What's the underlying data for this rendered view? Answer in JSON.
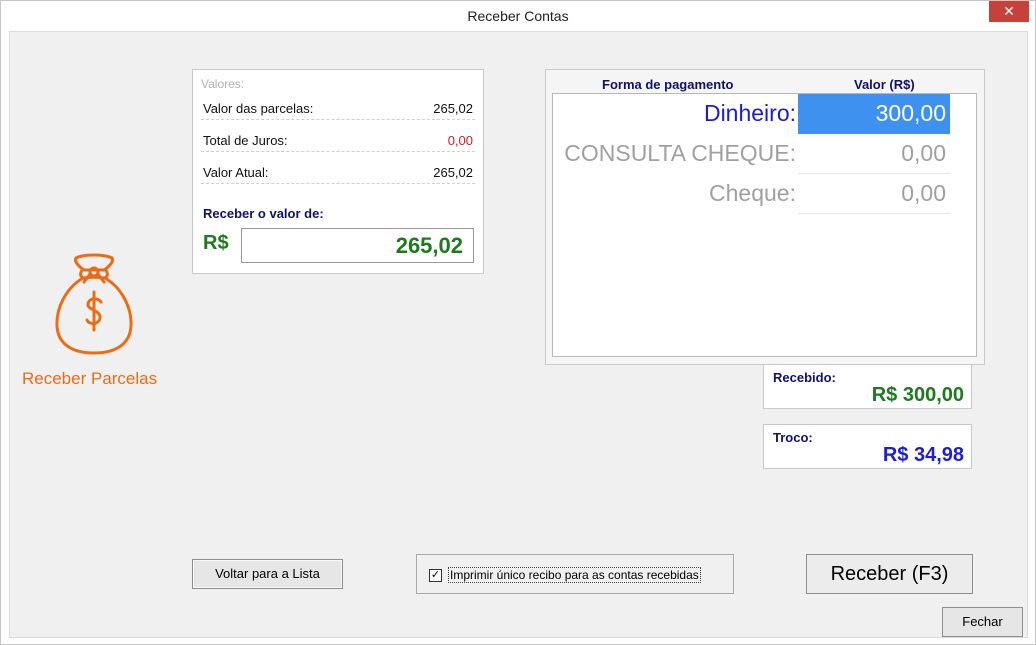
{
  "window": {
    "title": "Receber Contas",
    "close_glyph": "✕"
  },
  "logo": {
    "icon": "money-bag-icon",
    "label": "Receber Parcelas",
    "color": "#ec6c16"
  },
  "values": {
    "legend": "Valores:",
    "rows": [
      {
        "label": "Valor das parcelas:",
        "value": "265,02"
      },
      {
        "label": "Total de Juros:",
        "value": "0,00"
      },
      {
        "label": "Valor Atual:",
        "value": "265,02"
      }
    ],
    "receber_label": "Receber o valor de:",
    "currency": "R$",
    "receber_value": "265,02"
  },
  "payment": {
    "col_forma": "Forma de pagamento",
    "col_valor": "Valor (R$)",
    "methods": [
      {
        "label": "Dinheiro:",
        "value": "300,00",
        "selected": true
      },
      {
        "label": "CONSULTA CHEQUE:",
        "value": "0,00",
        "selected": false
      },
      {
        "label": "Cheque:",
        "value": "0,00",
        "selected": false
      }
    ]
  },
  "totals": {
    "recebido_label": "Recebido:",
    "recebido_value": "R$ 300,00",
    "troco_label": "Troco:",
    "troco_value": "R$ 34,98"
  },
  "actions": {
    "voltar": "Voltar para a Lista",
    "print_checked": true,
    "print_check_glyph": "✓",
    "print_label": "Imprimir único recibo para as contas recebidas",
    "receber": "Receber (F3)",
    "fechar": "Fechar"
  },
  "colors": {
    "accent_blue": "#3f91f0",
    "dark_navy": "#10106e",
    "money_green": "#1d7a1d",
    "troco_blue": "#1c1cdc",
    "juros_red": "#e0151c"
  }
}
